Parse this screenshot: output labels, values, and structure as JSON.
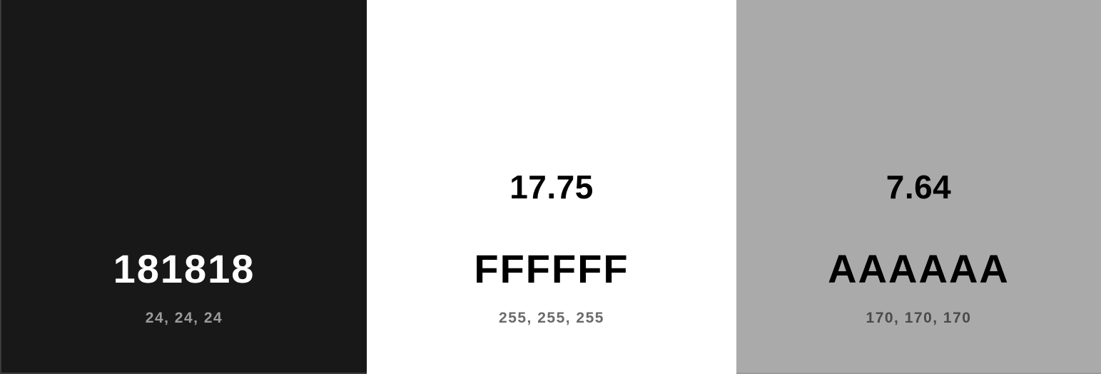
{
  "swatches": [
    {
      "hex": "181818",
      "rgb": "24, 24, 24",
      "ratio": "",
      "background": "#181818",
      "text_color": "#ffffff",
      "rgb_color": "#9b9b9b"
    },
    {
      "hex": "FFFFFF",
      "rgb": "255, 255, 255",
      "ratio": "17.75",
      "background": "#ffffff",
      "text_color": "#000000",
      "rgb_color": "#6a6a6a"
    },
    {
      "hex": "AAAAAA",
      "rgb": "170, 170, 170",
      "ratio": "7.64",
      "background": "#aaaaaa",
      "text_color": "#000000",
      "rgb_color": "#4a4a4a"
    }
  ]
}
